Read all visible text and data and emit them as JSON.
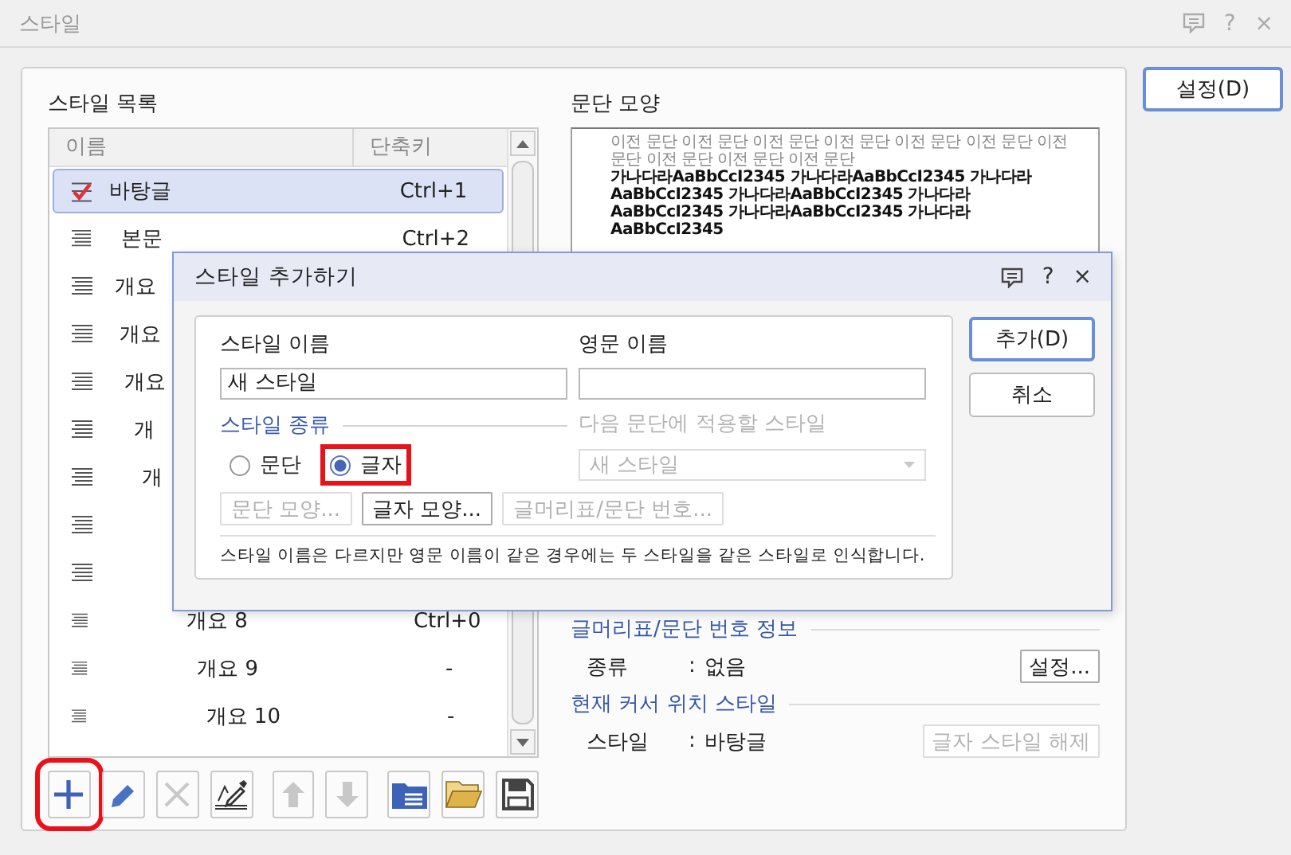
{
  "window": {
    "title": "스타일",
    "help": "?",
    "close": "×",
    "settings_button": "설정(D)"
  },
  "style_list": {
    "title": "스타일 목록",
    "columns": [
      "이름",
      "단축키"
    ],
    "rows": [
      {
        "name": "바탕글",
        "shortcut": "Ctrl+1",
        "selected": true,
        "current": true
      },
      {
        "name": "본문",
        "shortcut": "Ctrl+2",
        "selected": false,
        "current": false
      },
      {
        "name": "개요",
        "selected": false,
        "current": false
      },
      {
        "name": "개요",
        "selected": false,
        "current": false
      },
      {
        "name": "개요",
        "selected": false,
        "current": false
      },
      {
        "name": "개",
        "selected": false,
        "current": false
      },
      {
        "name": "개",
        "selected": false,
        "current": false
      },
      {
        "selected": false,
        "current": false
      },
      {
        "selected": false,
        "current": false
      },
      {
        "name": "개요 8",
        "shortcut": "Ctrl+0",
        "selected": false,
        "current": false
      },
      {
        "name": "개요 9",
        "shortcut": "-",
        "selected": false,
        "current": false
      },
      {
        "name": "개요 10",
        "shortcut": "-",
        "selected": false,
        "current": false
      }
    ]
  },
  "toolbar": [
    {
      "kind": "add",
      "disabled": false,
      "highlighted": true
    },
    {
      "kind": "edit",
      "disabled": false,
      "highlighted": false
    },
    {
      "kind": "delete",
      "disabled": true,
      "highlighted": false
    },
    {
      "kind": "eyedropper",
      "disabled": false,
      "highlighted": false
    },
    {
      "kind": "up",
      "disabled": true,
      "highlighted": false
    },
    {
      "kind": "down",
      "disabled": true,
      "highlighted": false
    },
    {
      "kind": "import",
      "disabled": false,
      "highlighted": false
    },
    {
      "kind": "open",
      "disabled": false,
      "highlighted": false
    },
    {
      "kind": "save",
      "disabled": false,
      "highlighted": false
    }
  ],
  "preview": {
    "title": "문단 모양",
    "previous_text": "이전 문단 이전 문단 이전 문단 이전 문단 이전 문단 이전 문단 이전 문단 이전 문단 이전 문단 이전 문단",
    "sample_text": "가나다라AaBbCcI2345 가나다라AaBbCcI2345 가나다라AaBbCcI2345 가나다라AaBbCcI2345 가나다라AaBbCcI2345 가나다라AaBbCcI2345 가나다라AaBbCcI2345"
  },
  "bullet_info": {
    "title": "글머리표/문단 번호 정보",
    "label": "종류",
    "separator": ":",
    "value": "없음",
    "button": {
      "label": "설정...",
      "disabled": false
    }
  },
  "cursor_style": {
    "title": "현재 커서 위치 스타일",
    "label": "스타일",
    "separator": ":",
    "value": "바탕글",
    "button": {
      "label": "글자 스타일 해제",
      "disabled": true
    }
  },
  "dialog": {
    "title": "스타일 추가하기",
    "help": "?",
    "close": "×",
    "name_label": "스타일 이름",
    "name_value": "새 스타일",
    "english_label": "영문 이름",
    "type_label": "스타일 종류",
    "types": [
      {
        "label": "문단",
        "selected": false,
        "highlighted": false
      },
      {
        "label": "글자",
        "selected": true,
        "highlighted": true
      }
    ],
    "next_style_label": "다음 문단에 적용할 스타일",
    "next_style": {
      "value": "새 스타일",
      "disabled": true
    },
    "buttons": [
      {
        "label": "문단 모양...",
        "disabled": true
      },
      {
        "label": "글자 모양...",
        "disabled": false
      },
      {
        "label": "글머리표/문단 번호...",
        "disabled": true
      }
    ],
    "note": "스타일 이름은 다르지만 영문 이름이 같은 경우에는 두 스타일을 같은 스타일로 인식합니다.",
    "actions": [
      {
        "label": "추가(D)",
        "default": true
      },
      {
        "label": "취소",
        "default": false
      }
    ]
  }
}
